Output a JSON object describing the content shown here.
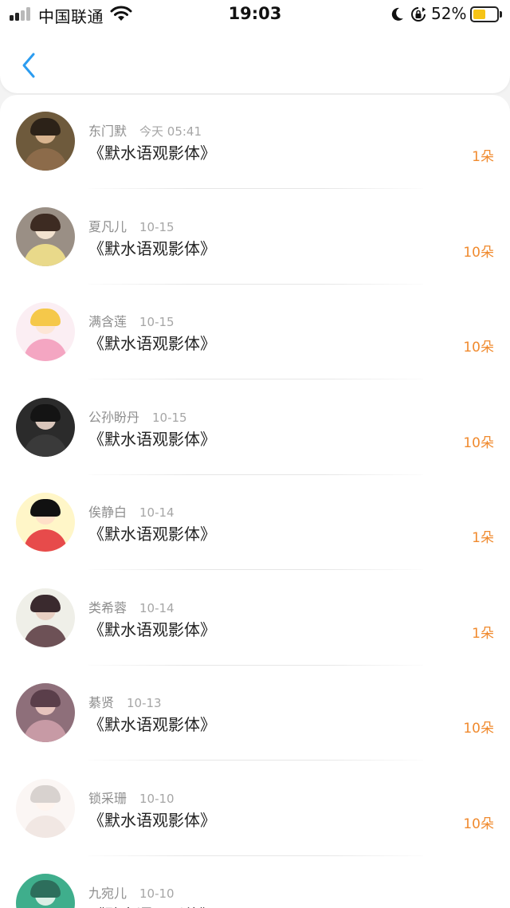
{
  "status_bar": {
    "carrier": "中国联通",
    "time": "19:03",
    "battery": "52%",
    "battery_level": 0.52,
    "signal_bars": 2,
    "icons": [
      "signal-icon",
      "wifi-icon",
      "moon-icon",
      "rotation-lock-icon",
      "battery-icon"
    ]
  },
  "nav": {
    "back_icon": "chevron-left-icon"
  },
  "colors": {
    "accent": "#2b9cf0",
    "count": "#f08a2e"
  },
  "entries": [
    {
      "name": "东门默",
      "date": "今天 05:41",
      "title": "《默水语观影体》",
      "count": "1朵"
    },
    {
      "name": "夏凡儿",
      "date": "10-15",
      "title": "《默水语观影体》",
      "count": "10朵"
    },
    {
      "name": "满含莲",
      "date": "10-15",
      "title": "《默水语观影体》",
      "count": "10朵"
    },
    {
      "name": "公孙盼丹",
      "date": "10-15",
      "title": "《默水语观影体》",
      "count": "10朵"
    },
    {
      "name": "俟静白",
      "date": "10-14",
      "title": "《默水语观影体》",
      "count": "1朵"
    },
    {
      "name": "类希蓉",
      "date": "10-14",
      "title": "《默水语观影体》",
      "count": "1朵"
    },
    {
      "name": "綦贤",
      "date": "10-13",
      "title": "《默水语观影体》",
      "count": "10朵"
    },
    {
      "name": "锁采珊",
      "date": "10-10",
      "title": "《默水语观影体》",
      "count": "10朵"
    },
    {
      "name": "九宛儿",
      "date": "10-10",
      "title": "《默水语观影体》",
      "count": ""
    }
  ]
}
